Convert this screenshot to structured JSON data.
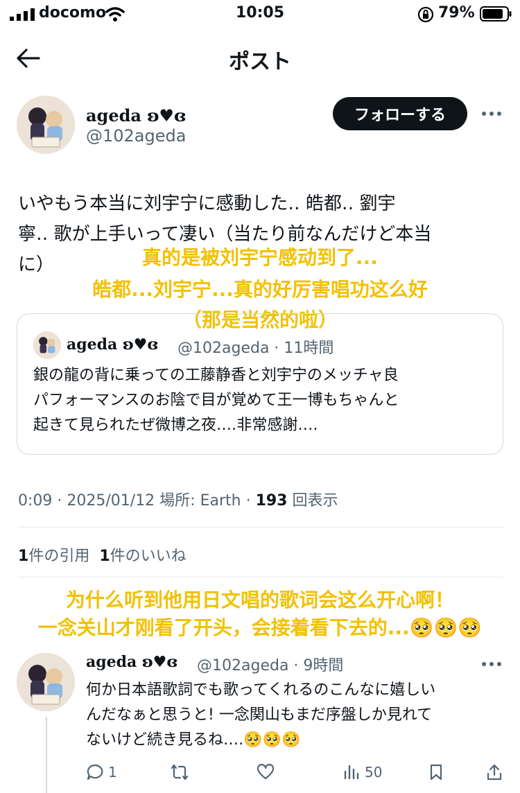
{
  "status_bar": {
    "carrier": "docomo",
    "time": "10:05",
    "battery": "79%"
  },
  "header": {
    "title": "ポスト"
  },
  "author": {
    "name": "ageda ʚ♥ɞ",
    "handle": "@102ageda",
    "follow_label": "フォローする"
  },
  "post": {
    "text": "いやもう本当に刘宇宁に感動した‥ 皓都‥ 劉宇\n寧‥ 歌が上手いって凄い（当たり前なんだけど本当\nに）",
    "caption_lines": [
      "真的是被刘宇宁感动到了...",
      "皓都...刘宇宁...真的好厉害唱功这么好",
      "（那是当然的啦）"
    ]
  },
  "quote": {
    "name": "ageda ʚ♥ɞ",
    "handle_time": "@102ageda · 11時間",
    "text": "銀の龍の背に乗っての工藤静香と刘宇宁のメッチャ良\nパフォーマンスのお陰で目が覚めて王一博もちゃんと\n起きて見られたぜ微博之夜‥‥非常感謝‥‥"
  },
  "meta": {
    "timestamp": "0:09 · 2025/01/12 場所: Earth · ",
    "views": "193",
    "views_label": " 回表示"
  },
  "stats": {
    "quotes_count": "1",
    "quotes_label": "件の引用",
    "likes_count": "1",
    "likes_label": "件のいいね"
  },
  "caption2": [
    "为什么听到他用日文唱的歌词会这么开心啊！",
    "一念关山才刚看了开头，会接着看下去的...🥺🥺🥺"
  ],
  "reply": {
    "name": "ageda ʚ♥ɞ",
    "handle_time": "@102ageda · 9時間",
    "text": "何か日本語歌詞でも歌ってくれるのこんなに嬉しい\nんだなぁと思うと! 一念関山もまだ序盤しか見れて\nないけど続き見るね‥‥🥺🥺🥺",
    "actions": {
      "replies": "1",
      "views": "50"
    }
  },
  "colors": {
    "caption": "#f2c100",
    "muted": "#536471",
    "text": "#0f1419"
  }
}
